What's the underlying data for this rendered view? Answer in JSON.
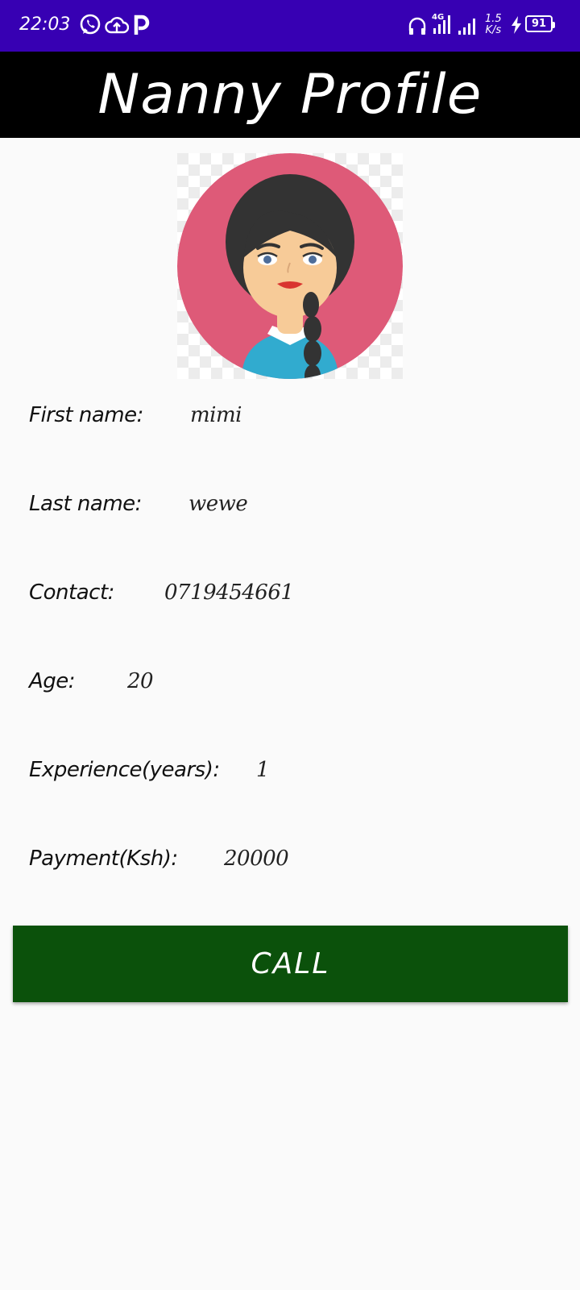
{
  "status_bar": {
    "time": "22:03",
    "network_type": "4G",
    "net_speed_value": "1.5",
    "net_speed_unit": "K/s",
    "battery": "91",
    "icons": [
      "whatsapp-icon",
      "cloud-upload-icon",
      "p-icon",
      "headset-icon",
      "signal-4g-icon",
      "signal-icon",
      "charging-icon",
      "battery-icon"
    ]
  },
  "header": {
    "title": "Nanny Profile"
  },
  "profile": {
    "avatar": "nanny-avatar",
    "fields": [
      {
        "label": "First name:",
        "value": "mimi"
      },
      {
        "label": "Last name:",
        "value": "wewe"
      },
      {
        "label": "Contact:",
        "value": "0719454661"
      },
      {
        "label": "Age:",
        "value": "20"
      },
      {
        "label": "Experience(years):",
        "value": "1"
      },
      {
        "label": "Payment(Ksh):",
        "value": "20000"
      }
    ]
  },
  "actions": {
    "call_label": "CALL"
  },
  "colors": {
    "status_bar": "#3700b3",
    "app_bar": "#000000",
    "call_button": "#0b510b",
    "avatar_background": "#de5a78"
  }
}
